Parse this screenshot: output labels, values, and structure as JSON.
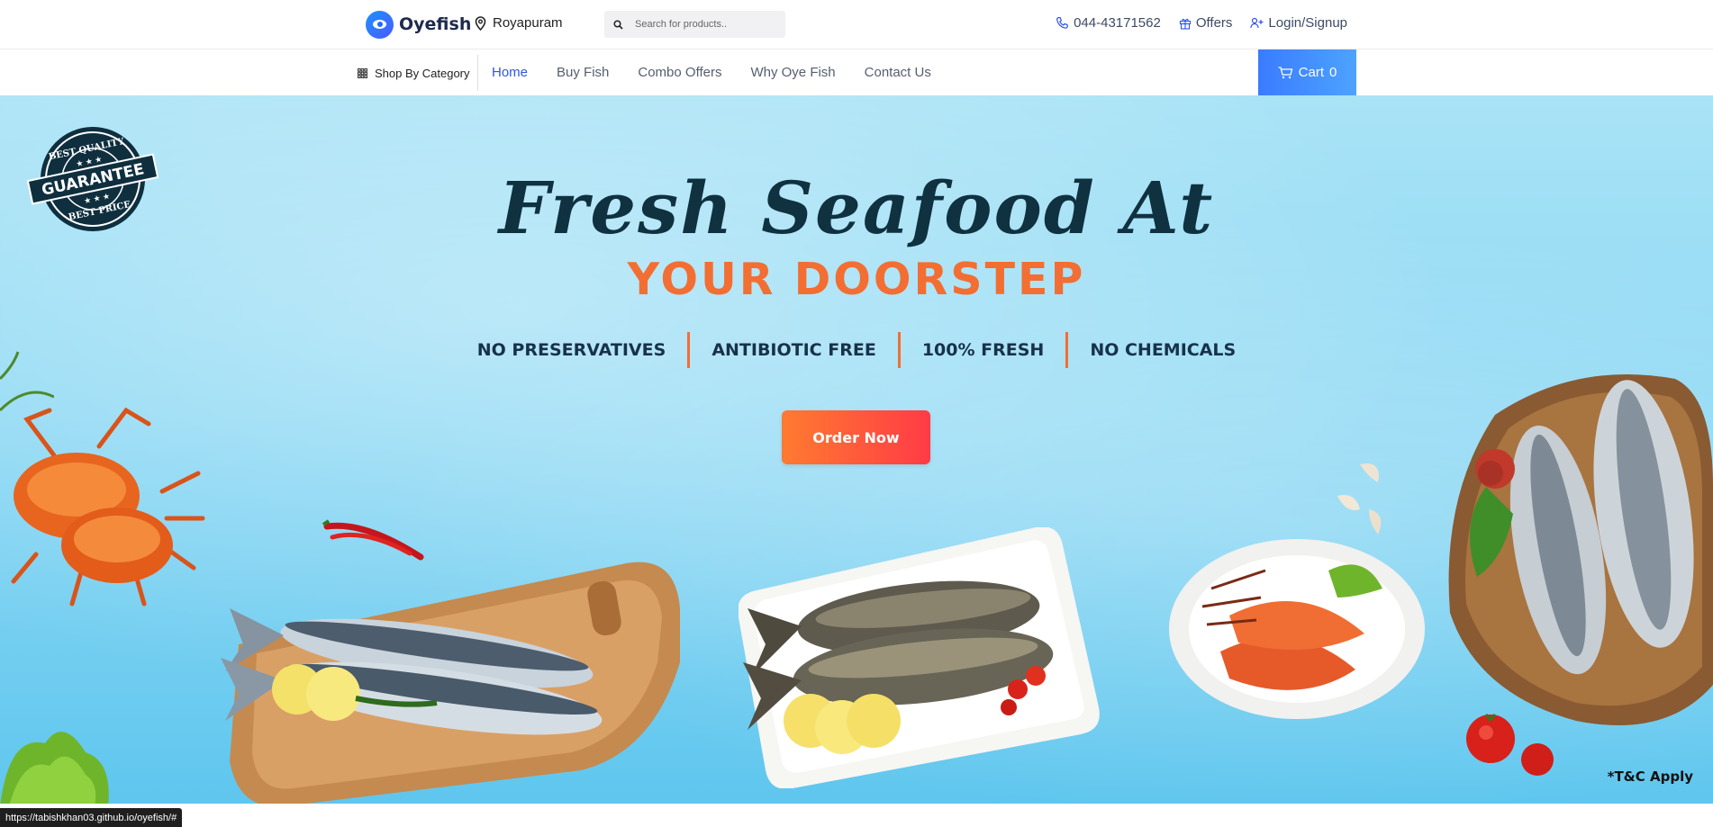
{
  "header": {
    "brand": "Oyefish",
    "location": "Royapuram",
    "search_placeholder": "Search for products..",
    "phone": "044-43171562",
    "offers": "Offers",
    "login": "Login/Signup"
  },
  "nav": {
    "shop_by_category": "Shop By Category",
    "items": [
      "Home",
      "Buy Fish",
      "Combo Offers",
      "Why Oye Fish",
      "Contact Us"
    ],
    "active": "Home",
    "cart_label": "Cart",
    "cart_count": "0"
  },
  "hero": {
    "title": "Fresh Seafood At",
    "subtitle": "YOUR DOORSTEP",
    "features": [
      "NO PRESERVATIVES",
      "ANTIBIOTIC FREE",
      "100% FRESH",
      "NO CHEMICALS"
    ],
    "cta": "Order Now",
    "badge_top": "BEST QUALITY",
    "badge_main": "GUARANTEE",
    "badge_bottom": "BEST PRICE",
    "terms": "*T&C Apply"
  },
  "status_url": "https://tabishkhan03.github.io/oyefish/#",
  "colors": {
    "accent_blue": "#2f55e4",
    "accent_orange": "#f36e32",
    "cart_blue": "#3a7bff",
    "cta_start": "#ff7b30",
    "cta_end": "#ff3b46",
    "sky": "#8fd9f4"
  }
}
